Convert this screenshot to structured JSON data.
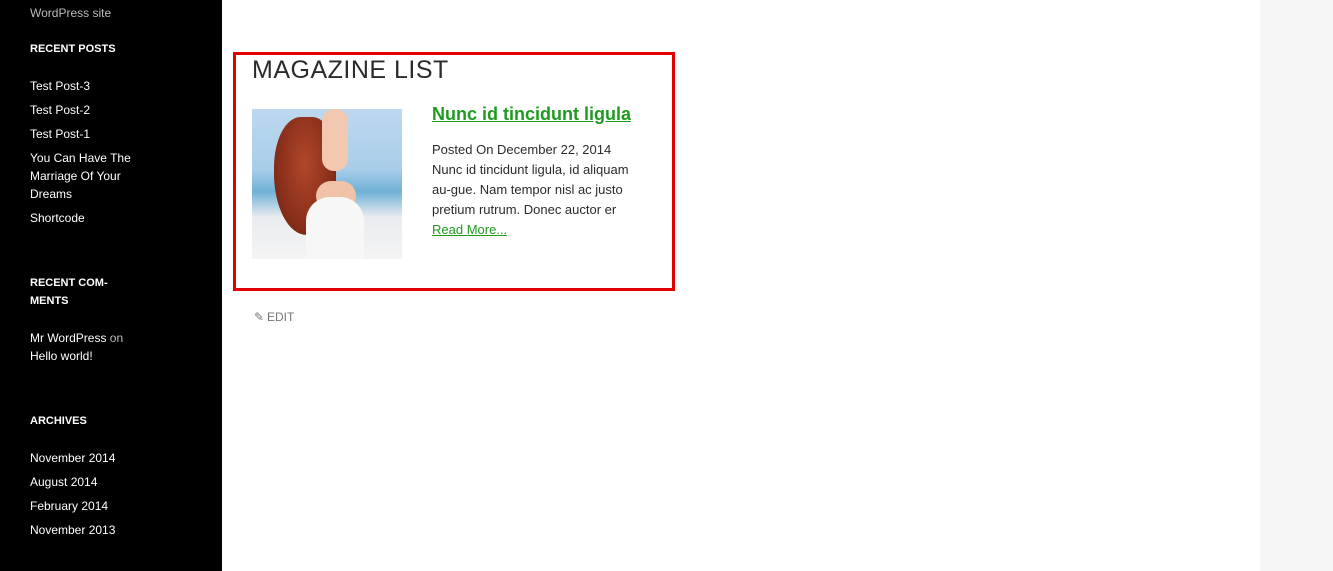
{
  "sidebar": {
    "tagline": "WordPress site",
    "recent_posts": {
      "title": "RECENT POSTS",
      "items": [
        "Test Post-3",
        "Test Post-2",
        "Test Post-1",
        "You Can Have The Marriage Of Your Dreams",
        "Shortcode"
      ]
    },
    "recent_comments": {
      "title": "RECENT COM-MENTS",
      "author": "Mr WordPress",
      "on": "on",
      "post": "Hello world!"
    },
    "archives": {
      "title": "ARCHIVES",
      "items": [
        "November 2014",
        "August 2014",
        "February 2014",
        "November 2013"
      ]
    }
  },
  "main": {
    "widget_title": "MAGAZINE LIST",
    "post": {
      "title": "Nunc id tincidunt ligula",
      "meta": "Posted On December 22, 2014",
      "excerpt": "Nunc id tincidunt ligula, id aliquam au-gue. Nam tempor nisl ac justo pretium rutrum. Donec auctor er",
      "read_more": "Read More..."
    },
    "edit_label": "EDIT"
  },
  "colors": {
    "link_green": "#1f9b1f",
    "highlight_red": "#e00000",
    "sidebar_bg": "#000000"
  }
}
